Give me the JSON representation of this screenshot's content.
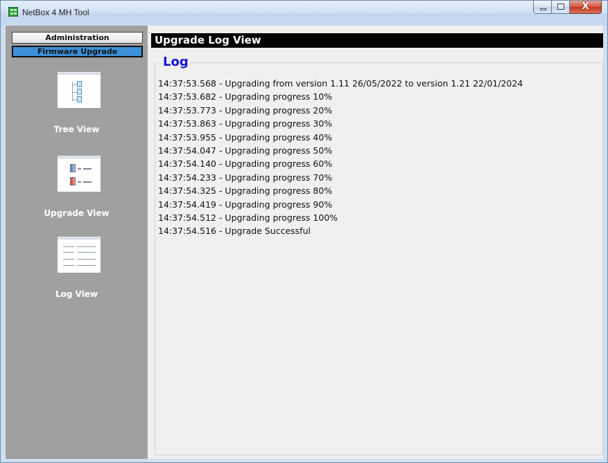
{
  "window": {
    "title": "NetBox 4 MH Tool",
    "close_glyph": "X"
  },
  "sidebar": {
    "tabs": [
      {
        "label": "Administration"
      },
      {
        "label": "Firmware Upgrade",
        "selected": true
      }
    ],
    "items": [
      {
        "label": "Tree View",
        "icon": "tree-view-icon"
      },
      {
        "label": "Upgrade View",
        "icon": "upgrade-view-icon"
      },
      {
        "label": "Log View",
        "icon": "log-view-icon"
      }
    ]
  },
  "main": {
    "header": "Upgrade Log View",
    "group_title": "Log",
    "log": [
      "14:37:53.568 - Upgrading from version 1.11 26/05/2022 to version 1.21 22/01/2024",
      "14:37:53.682 - Upgrading progress 10%",
      "14:37:53.773 - Upgrading progress 20%",
      "14:37:53.863 - Upgrading progress 30%",
      "14:37:53.955 - Upgrading progress 40%",
      "14:37:54.047 - Upgrading progress 50%",
      "14:37:54.140 - Upgrading progress 60%",
      "14:37:54.233 - Upgrading progress 70%",
      "14:37:54.325 - Upgrading progress 80%",
      "14:37:54.419 - Upgrading progress 90%",
      "14:37:54.512 - Upgrading progress 100%",
      "14:37:54.516 - Upgrade Successful"
    ]
  },
  "colors": {
    "sidebar_bg": "#a0a0a0",
    "selected_tab": "#3c90d8",
    "group_title": "#1414d6",
    "header_bg": "#000000"
  }
}
